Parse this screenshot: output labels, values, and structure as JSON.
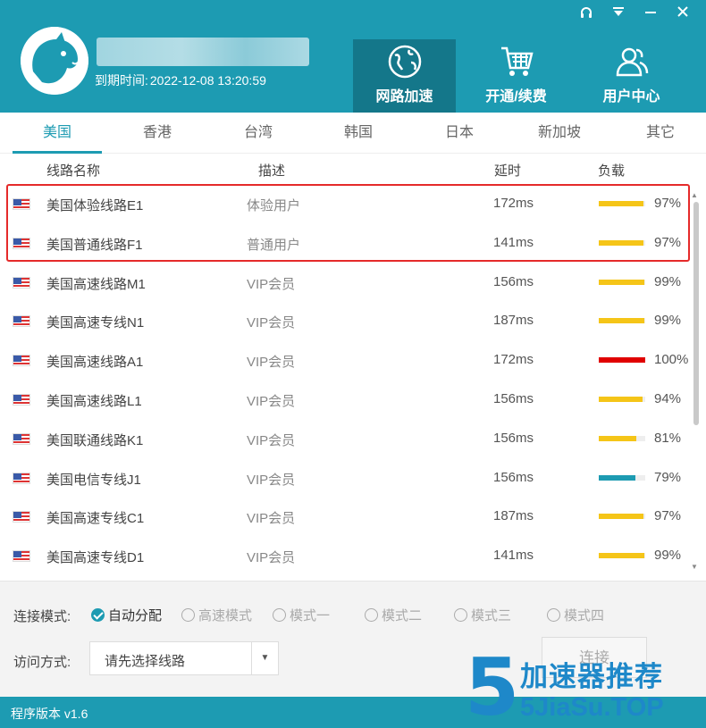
{
  "header": {
    "expire_label": "到期时间:",
    "expire_value": "2022-12-08 13:20:59",
    "nav": [
      {
        "label": "网路加速",
        "icon": "globe-icon",
        "active": true
      },
      {
        "label": "开通/续费",
        "icon": "cart-icon",
        "active": false
      },
      {
        "label": "用户中心",
        "icon": "users-icon",
        "active": false
      }
    ],
    "window_controls": [
      "headset-icon",
      "dropdown-icon",
      "minimize-icon",
      "close-icon"
    ]
  },
  "tabs": [
    "美国",
    "香港",
    "台湾",
    "韩国",
    "日本",
    "新加坡",
    "其它"
  ],
  "active_tab": "美国",
  "table": {
    "columns": [
      "线路名称",
      "描述",
      "延时",
      "负载"
    ],
    "rows": [
      {
        "name": "美国体验线路E1",
        "desc": "体验用户",
        "latency": "172ms",
        "load": 97,
        "load_text": "97%",
        "color": "#f5c518"
      },
      {
        "name": "美国普通线路F1",
        "desc": "普通用户",
        "latency": "141ms",
        "load": 97,
        "load_text": "97%",
        "color": "#f5c518"
      },
      {
        "name": "美国高速线路M1",
        "desc": "VIP会员",
        "latency": "156ms",
        "load": 99,
        "load_text": "99%",
        "color": "#f5c518"
      },
      {
        "name": "美国高速专线N1",
        "desc": "VIP会员",
        "latency": "187ms",
        "load": 99,
        "load_text": "99%",
        "color": "#f5c518"
      },
      {
        "name": "美国高速线路A1",
        "desc": "VIP会员",
        "latency": "172ms",
        "load": 100,
        "load_text": "100%",
        "color": "#e00000"
      },
      {
        "name": "美国高速线路L1",
        "desc": "VIP会员",
        "latency": "156ms",
        "load": 94,
        "load_text": "94%",
        "color": "#f5c518"
      },
      {
        "name": "美国联通线路K1",
        "desc": "VIP会员",
        "latency": "156ms",
        "load": 81,
        "load_text": "81%",
        "color": "#f5c518"
      },
      {
        "name": "美国电信专线J1",
        "desc": "VIP会员",
        "latency": "156ms",
        "load": 79,
        "load_text": "79%",
        "color": "#1d9bb2"
      },
      {
        "name": "美国高速专线C1",
        "desc": "VIP会员",
        "latency": "187ms",
        "load": 97,
        "load_text": "97%",
        "color": "#f5c518"
      },
      {
        "name": "美国高速专线D1",
        "desc": "VIP会员",
        "latency": "141ms",
        "load": 99,
        "load_text": "99%",
        "color": "#f5c518"
      }
    ]
  },
  "settings": {
    "mode_label": "连接模式:",
    "modes": [
      {
        "label": "自动分配",
        "selected": true
      },
      {
        "label": "高速模式",
        "selected": false
      },
      {
        "label": "模式一",
        "selected": false
      },
      {
        "label": "模式二",
        "selected": false
      },
      {
        "label": "模式三",
        "selected": false
      },
      {
        "label": "模式四",
        "selected": false
      }
    ],
    "access_label": "访问方式:",
    "access_value": "请先选择线路",
    "connect_label": "连接"
  },
  "footer": {
    "version": "程序版本 v1.6"
  },
  "watermark": {
    "digit": "5",
    "cn": "加速器推荐",
    "en": "5JiaSu.TOP"
  }
}
